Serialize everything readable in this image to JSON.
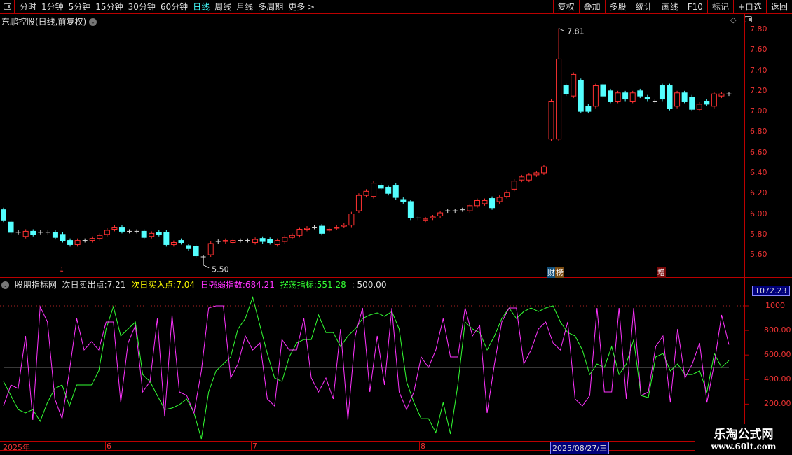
{
  "toolbar": {
    "periods": [
      "分时",
      "1分钟",
      "5分钟",
      "15分钟",
      "30分钟",
      "60分钟",
      "日线",
      "周线",
      "月线",
      "多周期",
      "更多 >"
    ],
    "active": "日线",
    "right_buttons": [
      "复权",
      "叠加",
      "多股",
      "统计",
      "画线",
      "F10",
      "标记",
      "+自选",
      "返回"
    ]
  },
  "stock_title": "东鹏控股(日线,前复权)",
  "price_axis": {
    "labels": [
      "7.80",
      "7.60",
      "7.40",
      "7.20",
      "7.00",
      "6.80",
      "6.60",
      "6.40",
      "6.20",
      "6.00",
      "5.80",
      "5.60"
    ],
    "max": 7.8,
    "min": 5.6
  },
  "price_markers": {
    "high": "7.81",
    "low": "5.50"
  },
  "badges": {
    "fin": "财",
    "rank": "榜",
    "inc": "增"
  },
  "candles": [
    [
      6.04,
      5.94
    ],
    [
      5.92,
      5.82
    ],
    [
      5.82,
      5.82
    ],
    [
      5.78,
      5.83
    ],
    [
      5.83,
      5.8
    ],
    [
      5.82,
      5.82
    ],
    [
      5.82,
      5.82
    ],
    [
      5.82,
      5.77
    ],
    [
      5.8,
      5.74
    ],
    [
      5.74,
      5.7
    ],
    [
      5.7,
      5.74
    ],
    [
      5.74,
      5.74
    ],
    [
      5.74,
      5.76
    ],
    [
      5.76,
      5.79
    ],
    [
      5.8,
      5.84
    ],
    [
      5.85,
      5.87
    ],
    [
      5.87,
      5.83
    ],
    [
      5.83,
      5.83
    ],
    [
      5.83,
      5.83
    ],
    [
      5.83,
      5.77
    ],
    [
      5.78,
      5.81
    ],
    [
      5.82,
      5.8
    ],
    [
      5.82,
      5.7
    ],
    [
      5.7,
      5.72
    ],
    [
      5.74,
      5.72
    ],
    [
      5.69,
      5.66
    ],
    [
      5.68,
      5.59
    ],
    [
      5.58,
      5.58
    ],
    [
      5.6,
      5.71
    ],
    [
      5.73,
      5.73
    ],
    [
      5.73,
      5.74
    ],
    [
      5.72,
      5.74
    ],
    [
      5.74,
      5.74
    ],
    [
      5.74,
      5.74
    ],
    [
      5.72,
      5.75
    ],
    [
      5.76,
      5.73
    ],
    [
      5.75,
      5.72
    ],
    [
      5.7,
      5.74
    ],
    [
      5.73,
      5.77
    ],
    [
      5.77,
      5.79
    ],
    [
      5.79,
      5.85
    ],
    [
      5.85,
      5.86
    ],
    [
      5.87,
      5.87
    ],
    [
      5.88,
      5.81
    ],
    [
      5.84,
      5.85
    ],
    [
      5.86,
      5.87
    ],
    [
      5.88,
      5.89
    ],
    [
      5.89,
      6.0
    ],
    [
      6.03,
      6.18
    ],
    [
      6.18,
      6.22
    ],
    [
      6.17,
      6.3
    ],
    [
      6.28,
      6.25
    ],
    [
      6.26,
      6.2
    ],
    [
      6.28,
      6.16
    ],
    [
      6.14,
      6.12
    ],
    [
      6.12,
      5.96
    ],
    [
      5.96,
      5.96
    ],
    [
      5.94,
      5.95
    ],
    [
      5.96,
      5.97
    ],
    [
      5.98,
      6.01
    ],
    [
      6.03,
      6.03
    ],
    [
      6.03,
      6.03
    ],
    [
      6.04,
      6.04
    ],
    [
      6.03,
      6.08
    ],
    [
      6.08,
      6.13
    ],
    [
      6.1,
      6.13
    ],
    [
      6.15,
      6.06
    ],
    [
      6.12,
      6.16
    ],
    [
      6.17,
      6.21
    ],
    [
      6.24,
      6.32
    ],
    [
      6.33,
      6.36
    ],
    [
      6.33,
      6.38
    ],
    [
      6.38,
      6.4
    ],
    [
      6.4,
      6.46
    ],
    [
      6.73,
      7.1
    ],
    [
      6.73,
      7.51
    ],
    [
      7.25,
      7.17
    ],
    [
      7.15,
      7.36
    ],
    [
      7.3,
      7.0
    ],
    [
      7.05,
      7.0
    ],
    [
      7.05,
      7.25
    ],
    [
      7.26,
      7.15
    ],
    [
      7.2,
      7.1
    ],
    [
      7.1,
      7.18
    ],
    [
      7.18,
      7.12
    ],
    [
      7.1,
      7.18
    ],
    [
      7.2,
      7.15
    ],
    [
      7.14,
      7.12
    ],
    [
      7.1,
      7.1
    ],
    [
      7.25,
      7.12
    ],
    [
      7.25,
      7.03
    ],
    [
      7.05,
      7.18
    ],
    [
      7.18,
      7.1
    ],
    [
      7.14,
      7.02
    ],
    [
      7.02,
      7.07
    ],
    [
      7.1,
      7.07
    ],
    [
      7.05,
      7.17
    ],
    [
      7.15,
      7.17
    ],
    [
      7.17,
      7.17
    ]
  ],
  "indicator": {
    "name": "股朋指标网",
    "sell_label": "次日卖出点:",
    "sell": "7.21",
    "buy_label": "次日买入点:",
    "buy": "7.04",
    "strength_label": "日强弱指数:",
    "strength": "684.21",
    "swing_label": "摆荡指标:",
    "swing": "551.28",
    "ref": ": 500.00",
    "ref_value": 500,
    "current": "1072.23",
    "axis_labels": [
      "1000",
      "800.00",
      "600.00",
      "400.00",
      "200.00"
    ],
    "axis_values": [
      1000,
      800,
      600,
      400,
      200
    ],
    "colors": {
      "strength": "#ff33ff",
      "swing": "#33ff33",
      "ref": "#dddddd",
      "sell": "#dddddd",
      "buy": "#ffff00"
    },
    "strength_series": [
      185,
      356,
      327,
      755,
      71,
      994,
      869,
      242,
      82,
      470,
      897,
      641,
      709,
      641,
      869,
      869,
      213,
      698,
      840,
      299,
      384,
      897,
      99,
      926,
      299,
      270,
      128,
      470,
      983,
      1000,
      1000,
      413,
      527,
      755,
      641,
      698,
      242,
      185,
      726,
      641,
      641,
      897,
      413,
      299,
      413,
      242,
      812,
      71,
      755,
      983,
      299,
      755,
      356,
      983,
      299,
      156,
      299,
      584,
      498,
      641,
      897,
      584,
      584,
      983,
      755,
      840,
      128,
      527,
      869,
      983,
      983,
      527,
      641,
      812,
      869,
      698,
      641,
      869,
      242,
      185,
      270,
      983,
      299,
      299,
      983,
      242,
      983,
      270,
      299,
      669,
      755,
      213,
      812,
      413,
      527,
      698,
      213,
      527,
      926,
      684
    ],
    "swing_series": [
      384,
      270,
      156,
      128,
      156,
      60,
      213,
      327,
      356,
      185,
      356,
      356,
      356,
      470,
      812,
      994,
      755,
      812,
      869,
      441,
      384,
      270,
      156,
      168,
      196,
      242,
      128,
      -83,
      299,
      470,
      527,
      584,
      812,
      897,
      1070,
      840,
      612,
      413,
      384,
      584,
      698,
      726,
      726,
      926,
      783,
      783,
      669,
      755,
      812,
      897,
      926,
      943,
      915,
      954,
      812,
      384,
      213,
      82,
      82,
      -32,
      213,
      -43,
      356,
      869,
      812,
      783,
      641,
      755,
      897,
      983,
      897,
      954,
      983,
      954,
      983,
      1000,
      869,
      783,
      755,
      641,
      441,
      527,
      498,
      669,
      441,
      527,
      726,
      270,
      253,
      584,
      612,
      470,
      527,
      441,
      441,
      470,
      299,
      612,
      498,
      555
    ]
  },
  "date_axis": {
    "labels": [
      "2025年",
      "6",
      "7",
      "8"
    ],
    "current": "2025/08/27/三"
  },
  "watermark": {
    "title": "乐淘公式网",
    "url": "www.60lt.com"
  }
}
